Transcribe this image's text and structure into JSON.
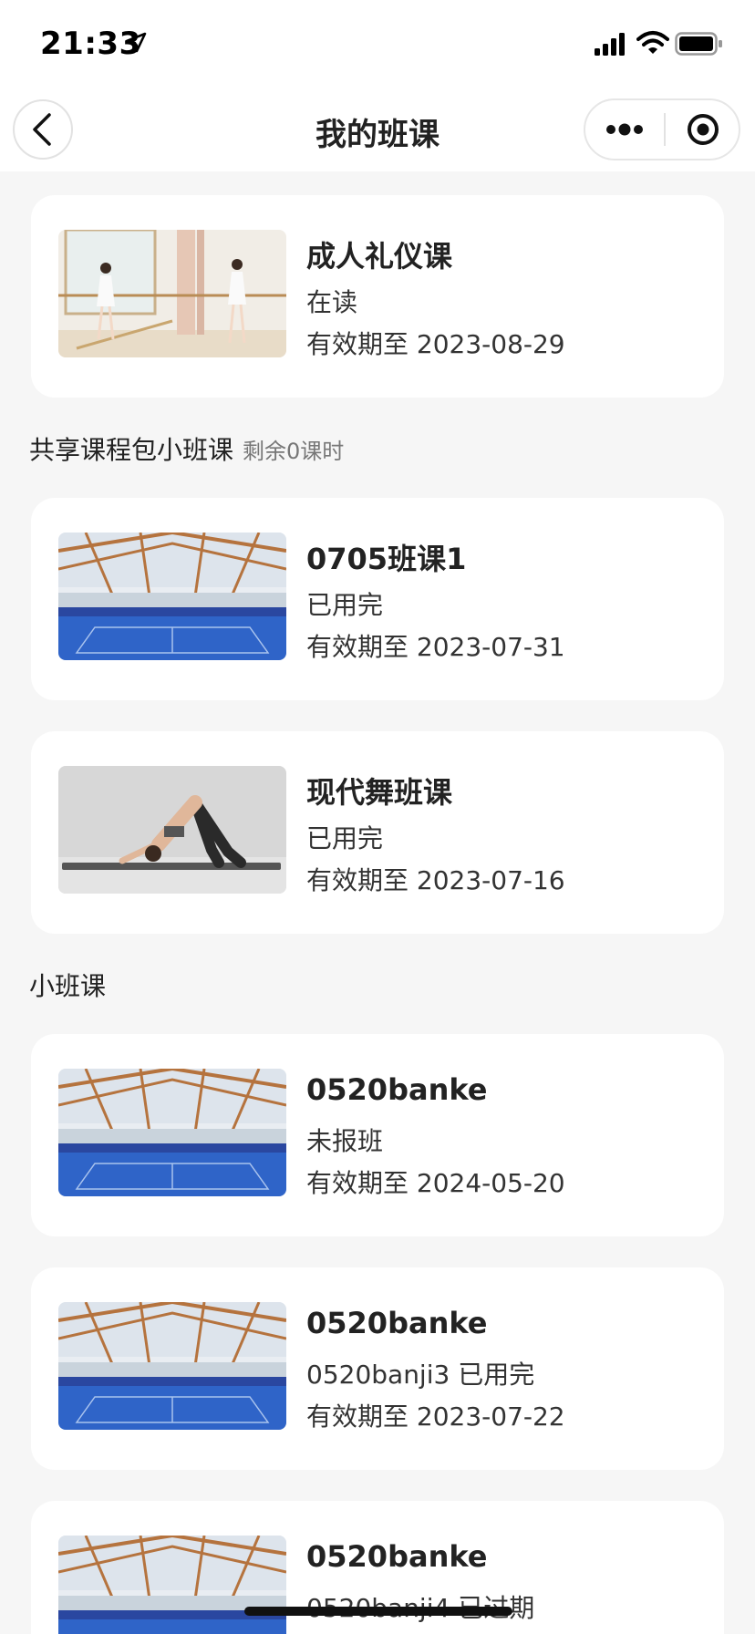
{
  "status_bar": {
    "time": "21:33"
  },
  "nav": {
    "title": "我的班课"
  },
  "top_card": {
    "title": "成人礼仪课",
    "status": "在读",
    "expiry": "有效期至 2023-08-29",
    "image": "ballet-studio-photo"
  },
  "shared_section": {
    "title": "共享课程包小班课",
    "remaining": "剩余0课时",
    "cards": [
      {
        "title": "0705班课1",
        "status": "已用完",
        "expiry": "有效期至 2023-07-31",
        "image": "sports-hall-photo"
      },
      {
        "title": "现代舞班课",
        "status": "已用完",
        "expiry": "有效期至 2023-07-16",
        "image": "yoga-pose-photo"
      }
    ]
  },
  "small_section": {
    "title": "小班课",
    "cards": [
      {
        "title": "0520banke",
        "status": "未报班",
        "expiry": "有效期至 2024-05-20",
        "image": "sports-hall-photo"
      },
      {
        "title": "0520banke",
        "status": "0520banji3 已用完",
        "expiry": "有效期至 2023-07-22",
        "image": "sports-hall-photo"
      },
      {
        "title": "0520banke",
        "status": "0520banji4 已过期",
        "expiry": "",
        "image": "sports-hall-photo"
      }
    ]
  },
  "colors": {
    "background": "#f6f6f6",
    "card": "#ffffff",
    "court_blue": "#2f64c8"
  }
}
